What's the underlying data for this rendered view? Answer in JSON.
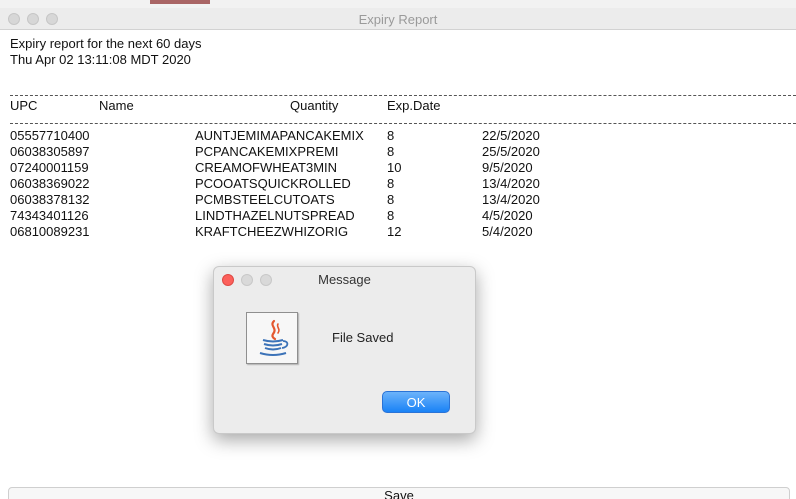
{
  "window": {
    "title": "Expiry Report"
  },
  "report": {
    "header_line1": "Expiry report for the next 60 days",
    "header_line2": "Thu Apr 02 13:11:08 MDT 2020",
    "columns": {
      "upc": "UPC",
      "name": "Name",
      "quantity": "Quantity",
      "exp_date": "Exp.Date"
    },
    "rows": [
      {
        "upc": "05557710400",
        "name": "AUNTJEMIMAPANCAKEMIX",
        "qty": "8",
        "exp": "22/5/2020"
      },
      {
        "upc": "06038305897",
        "name": "PCPANCAKEMIXPREMI",
        "qty": "8",
        "exp": "25/5/2020"
      },
      {
        "upc": "07240001159",
        "name": "CREAMOFWHEAT3MIN",
        "qty": "10",
        "exp": "9/5/2020"
      },
      {
        "upc": "06038369022",
        "name": "PCOOATSQUICKROLLED",
        "qty": "8",
        "exp": "13/4/2020"
      },
      {
        "upc": "06038378132",
        "name": "PCMBSTEELCUTOATS",
        "qty": "8",
        "exp": "13/4/2020"
      },
      {
        "upc": "74343401126",
        "name": "LINDTHAZELNUTSPREAD",
        "qty": "8",
        "exp": "4/5/2020"
      },
      {
        "upc": "06810089231",
        "name": "KRAFTCHEEZWHIZORIG",
        "qty": "12",
        "exp": "5/4/2020"
      }
    ]
  },
  "dialog": {
    "title": "Message",
    "message": "File Saved",
    "ok_label": "OK",
    "icon": "java-icon"
  },
  "footer": {
    "save_label": "Save"
  },
  "colors": {
    "close_dot": "#fc605b",
    "ok_button": "#1a82f6"
  }
}
